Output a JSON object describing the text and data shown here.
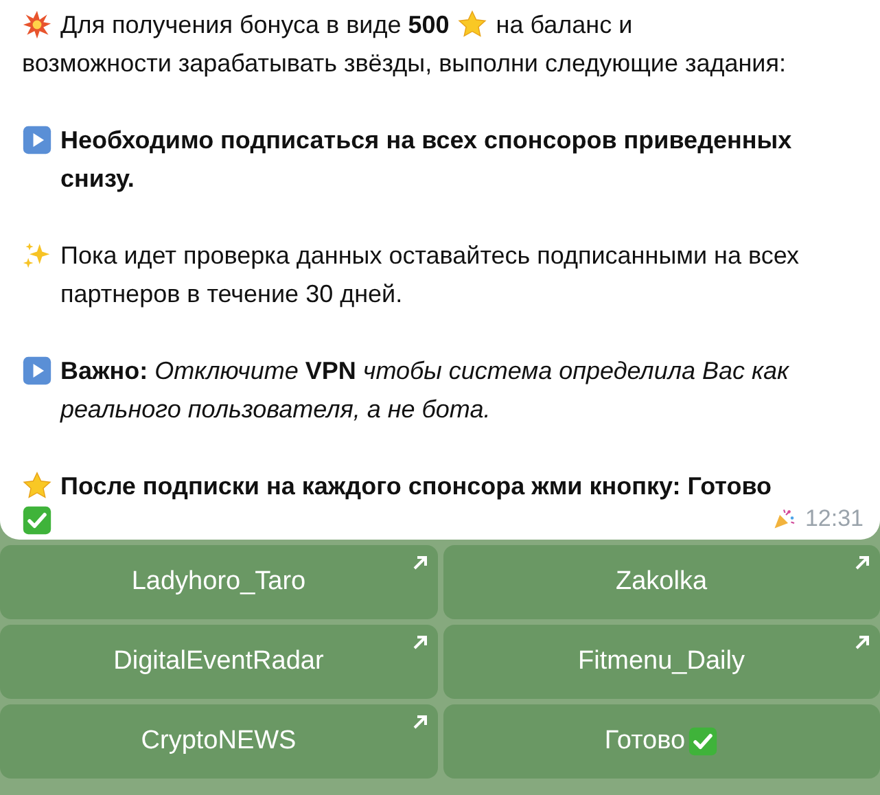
{
  "message": {
    "paragraphs": [
      {
        "kind": "plain",
        "rows": [
          [
            {
              "kind": "burst"
            },
            {
              "kind": "text",
              "text": "Для получения бонуса в виде **500**"
            },
            {
              "kind": "star"
            },
            {
              "kind": "text",
              "text": "на баланс и"
            }
          ],
          [
            {
              "kind": "text",
              "text": "возможности зарабатывать звёзды, выполни следующие задания:"
            }
          ]
        ]
      },
      {
        "kind": "bold",
        "rows": [
          [
            {
              "kind": "play"
            },
            {
              "kind": "text",
              "text": "Необходимо подписаться на всех спонсоров приведенных снизу."
            }
          ]
        ]
      },
      {
        "kind": "plain",
        "rows": [
          [
            {
              "kind": "sparkle"
            },
            {
              "kind": "text",
              "text": "Пока идет проверка данных оставайтесь подписанными на всех партнеров в течение 30 дней."
            }
          ]
        ]
      },
      {
        "kind": "plain",
        "rows": [
          [
            {
              "kind": "play"
            },
            {
              "kind": "text",
              "text": "**Важно:** *Отключите* **VPN** *чтобы система определила Вас как реального пользователя, а не бота.*"
            }
          ]
        ]
      },
      {
        "kind": "bold",
        "rows": [
          [
            {
              "kind": "star"
            },
            {
              "kind": "text",
              "text": "После подписки на каждого спонсора жми кнопку: Готово"
            }
          ],
          [
            {
              "kind": "check"
            }
          ]
        ]
      }
    ],
    "time": "12:31"
  },
  "buttons": [
    {
      "label": "Ladyhoro_Taro",
      "link": true,
      "check": false
    },
    {
      "label": "Zakolka",
      "link": true,
      "check": false
    },
    {
      "label": "DigitalEventRadar",
      "link": true,
      "check": false
    },
    {
      "label": "Fitmenu_Daily",
      "link": true,
      "check": false
    },
    {
      "label": "CryptoNEWS",
      "link": true,
      "check": false
    },
    {
      "label": "Готово",
      "link": false,
      "check": true
    }
  ]
}
